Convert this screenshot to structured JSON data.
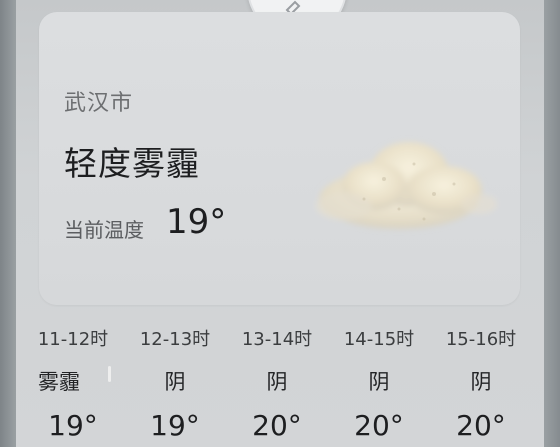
{
  "weather": {
    "city": "武汉市",
    "condition": "轻度雾霾",
    "temp_label": "当前温度",
    "temp_value": "19°",
    "icon": "haze-cloud-icon"
  },
  "hourly": [
    {
      "time": "11-12时",
      "condition": "雾霾",
      "temp": "19°"
    },
    {
      "time": "12-13时",
      "condition": "阴",
      "temp": "19°"
    },
    {
      "time": "13-14时",
      "condition": "阴",
      "temp": "20°"
    },
    {
      "time": "14-15时",
      "condition": "阴",
      "temp": "20°"
    },
    {
      "time": "15-16时",
      "condition": "阴",
      "temp": "20°"
    }
  ],
  "colors": {
    "card_bg": "#dadcde",
    "sheet_bg": "#cfd2d4",
    "text_primary": "#1d1e20",
    "text_secondary": "#6d6f71"
  }
}
